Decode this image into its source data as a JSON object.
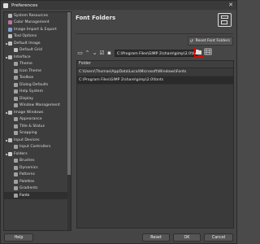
{
  "window": {
    "title": "Preferences",
    "close_glyph": "✕"
  },
  "sidebar": {
    "items": [
      {
        "label": "System Resources",
        "indent": 0,
        "expander": "",
        "icon_color": "#b0b8c0"
      },
      {
        "label": "Color Management",
        "indent": 0,
        "expander": "",
        "icon_color": "#c070a0"
      },
      {
        "label": "Image Import & Export",
        "indent": 0,
        "expander": "",
        "icon_color": "#80a0d0"
      },
      {
        "label": "Tool Options",
        "indent": 0,
        "expander": "",
        "icon_color": "#c0c0c0"
      },
      {
        "label": "Default Image",
        "indent": 0,
        "expander": "▪",
        "icon_color": "#c0c0c0"
      },
      {
        "label": "Default Grid",
        "indent": 1,
        "expander": "",
        "icon_color": "#c0c0c0"
      },
      {
        "label": "Interface",
        "indent": 0,
        "expander": "▪",
        "icon_color": "#c0c0c0"
      },
      {
        "label": "Theme",
        "indent": 1,
        "expander": "",
        "icon_color": "#a0a0a0"
      },
      {
        "label": "Icon Theme",
        "indent": 1,
        "expander": "",
        "icon_color": "#a0a0a0"
      },
      {
        "label": "Toolbox",
        "indent": 1,
        "expander": "",
        "icon_color": "#a0a0a0"
      },
      {
        "label": "Dialog Defaults",
        "indent": 1,
        "expander": "",
        "icon_color": "#a0a0a0"
      },
      {
        "label": "Help System",
        "indent": 1,
        "expander": "",
        "icon_color": "#a0a0a0"
      },
      {
        "label": "Display",
        "indent": 1,
        "expander": "",
        "icon_color": "#a0a0a0"
      },
      {
        "label": "Window Management",
        "indent": 1,
        "expander": "",
        "icon_color": "#a0a0a0"
      },
      {
        "label": "Image Windows",
        "indent": 0,
        "expander": "▪",
        "icon_color": "#c0c0c0"
      },
      {
        "label": "Appearance",
        "indent": 1,
        "expander": "",
        "icon_color": "#a0a0a0"
      },
      {
        "label": "Title & Status",
        "indent": 1,
        "expander": "",
        "icon_color": "#a0a0a0"
      },
      {
        "label": "Snapping",
        "indent": 1,
        "expander": "",
        "icon_color": "#a0a0a0"
      },
      {
        "label": "Input Devices",
        "indent": 0,
        "expander": "▪",
        "icon_color": "#c0c0c0"
      },
      {
        "label": "Input Controllers",
        "indent": 1,
        "expander": "",
        "icon_color": "#a0a0a0"
      },
      {
        "label": "Folders",
        "indent": 0,
        "expander": "▪",
        "icon_color": "#d0d0d0"
      },
      {
        "label": "Brushes",
        "indent": 1,
        "expander": "",
        "icon_color": "#a0a0a0"
      },
      {
        "label": "Dynamics",
        "indent": 1,
        "expander": "",
        "icon_color": "#a0a0a0"
      },
      {
        "label": "Patterns",
        "indent": 1,
        "expander": "",
        "icon_color": "#a0a0a0"
      },
      {
        "label": "Palettes",
        "indent": 1,
        "expander": "",
        "icon_color": "#a0a0a0"
      },
      {
        "label": "Gradients",
        "indent": 1,
        "expander": "",
        "icon_color": "#a0a0a0"
      },
      {
        "label": "Fonts",
        "indent": 1,
        "expander": "",
        "icon_color": "#a0a0a0",
        "selected": true
      }
    ]
  },
  "content": {
    "heading": "Font Folders",
    "reset_label": "Reset Font Folders",
    "path_value": "C:\\Program Files\\GIMP 2\\share\\gimp\\2.0\\fonts",
    "column_header": "Folder",
    "rows": [
      "C:\\Users\\Thomas\\AppData\\Local\\Microsoft\\Windows\\Fonts",
      "C:\\Program Files\\GIMP 2\\share\\gimp\\2.0\\fonts"
    ]
  },
  "footer": {
    "help": "Help",
    "reset": "Reset",
    "ok": "OK",
    "cancel": "Cancel"
  }
}
